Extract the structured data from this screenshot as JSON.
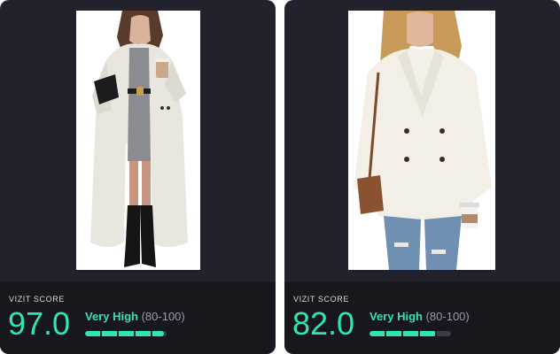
{
  "colors": {
    "accent": "#2ee6b4",
    "card_bg": "#22222c",
    "panel_bg": "#17171d"
  },
  "cards": [
    {
      "image": "long white faux-fur teddy coat over grey dress, black boots, black handbag and coffee cup",
      "score_label": "VIZIT SCORE",
      "score": "97.0",
      "level": "Very High",
      "range": "(80-100)",
      "score_fraction": 0.97
    },
    {
      "image": "short cream teddy peacoat with ripped jeans, brown crossbody bag and coffee cup",
      "score_label": "VIZIT SCORE",
      "score": "82.0",
      "level": "Very High",
      "range": "(80-100)",
      "score_fraction": 0.82
    }
  ]
}
